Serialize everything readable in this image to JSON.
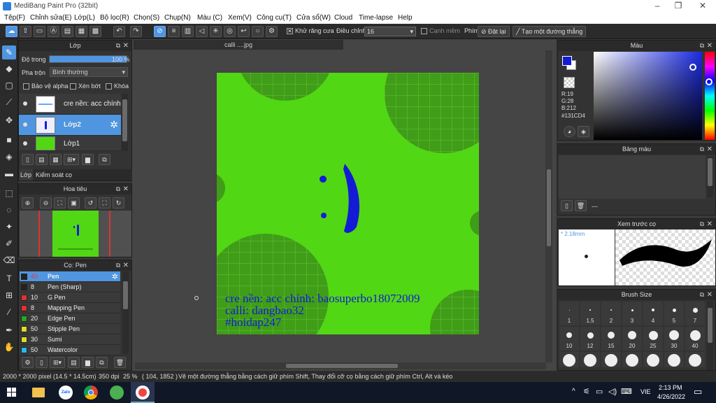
{
  "window": {
    "title": "MediBang Paint Pro (32bit)"
  },
  "menu": [
    "Tệp(F)",
    "Chỉnh sửa(E)",
    "Lớp(L)",
    "Bộ lọc(R)",
    "Chọn(S)",
    "Chụp(N)",
    "Màu (C)",
    "Xem(V)",
    "Công cụ(T)",
    "Cửa sổ(W)",
    "Cloud",
    "Time-lapse",
    "Help"
  ],
  "toolbar": {
    "antialias_label": "Khử răng cưa",
    "adjust_label": "Điều chỉnh",
    "adjust_value": "16",
    "edge_label": "Cạnh mềm",
    "key_label": "Phím",
    "reset_label": "Đặt lại",
    "straight_label": "Tạo một đường thẳng"
  },
  "layer_panel": {
    "title": "Lớp",
    "opacity_label": "Độ trong",
    "opacity_value": "100 %",
    "opacity_fraction": 1.0,
    "blend_label": "Pha trộn",
    "blend_value": "Bình thường",
    "protect_alpha": "Bảo vệ alpha",
    "clip": "Xén bớt",
    "lock": "Khóa",
    "layers": [
      {
        "name": "cre nền: acc chính",
        "selected": false
      },
      {
        "name": "Lớp2",
        "selected": true
      },
      {
        "name": "Lớp1",
        "selected": false
      }
    ],
    "tabs": [
      "Lớp",
      "Kiểm soát cọ"
    ]
  },
  "navigator_panel": {
    "title": "Hoa tiêu"
  },
  "brush_panel": {
    "title": "Cọ: Pen",
    "brushes": [
      {
        "size": "40",
        "name": "Pen",
        "color": "#222222",
        "selected": true
      },
      {
        "size": "8",
        "name": "Pen (Sharp)",
        "color": "#222222",
        "selected": false
      },
      {
        "size": "10",
        "name": "G Pen",
        "color": "#e03030",
        "selected": false
      },
      {
        "size": "8",
        "name": "Mapping Pen",
        "color": "#e03030",
        "selected": false
      },
      {
        "size": "20",
        "name": "Edge Pen",
        "color": "#22aa22",
        "selected": false
      },
      {
        "size": "50",
        "name": "Stipple Pen",
        "color": "#dddd22",
        "selected": false
      },
      {
        "size": "30",
        "name": "Sumi",
        "color": "#dddd22",
        "selected": false
      },
      {
        "size": "50",
        "name": "Watercolor",
        "color": "#22bbee",
        "selected": false
      }
    ]
  },
  "document": {
    "tab_title": "calli ....jpg",
    "canvas_color": "#52d714",
    "ink_color": "#131CD4",
    "text_lines": [
      "cre nền: acc chính: baosuperbo18072009",
      "calli: dangbao32",
      "#hoidap247"
    ]
  },
  "color_panel": {
    "title": "Màu",
    "r": "R:19",
    "g": "G:28",
    "b": "B:212",
    "hex": "#131CD4"
  },
  "palette_panel": {
    "title": "Bảng màu",
    "value": "---"
  },
  "preview_panel": {
    "title": "Xem trước cọ",
    "size": "2.18mm"
  },
  "brush_size_panel": {
    "title": "Brush Size",
    "sizes": [
      "1",
      "1.5",
      "2",
      "3",
      "4",
      "5",
      "7",
      "10",
      "12",
      "15",
      "20",
      "25",
      "30",
      "40"
    ]
  },
  "statusbar": {
    "size": "2000 * 2000 pixel",
    "cm": "(14.5 * 14.5cm)",
    "dpi": "350 dpi",
    "zoom": "25 %",
    "coords": "( 104, 1852 )",
    "hint": "Vẽ một đường thẳng bằng cách giữ phím Shift, Thay đổi cỡ cọ bằng cách giữ phím Ctrl, Alt và kéo"
  },
  "taskbar": {
    "time": "2:13 PM",
    "date": "4/26/2022",
    "lang": "VIE"
  }
}
